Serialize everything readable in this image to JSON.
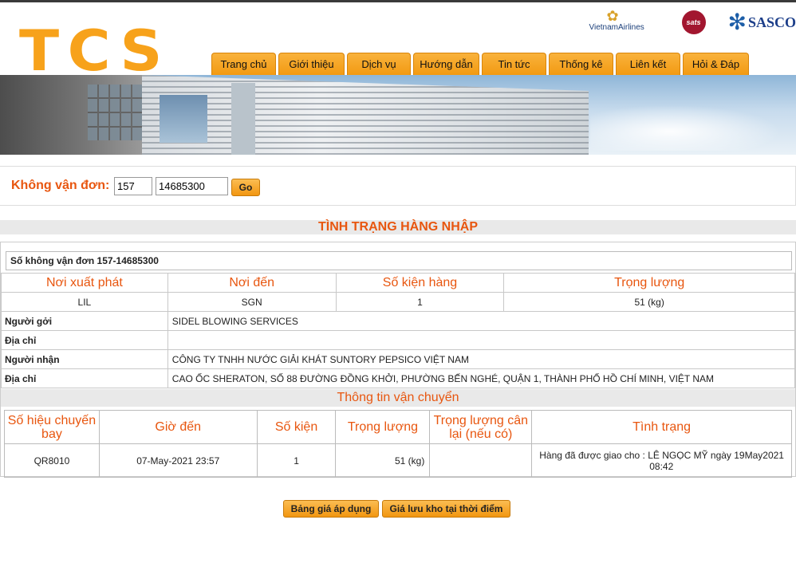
{
  "header": {
    "logo_text": "TCS",
    "partners": {
      "vietnam_airlines": "VietnamAirlines",
      "sats": "sats",
      "sasco": "SASCO"
    },
    "nav": [
      {
        "label": "Trang chủ"
      },
      {
        "label": "Giới thiệu"
      },
      {
        "label": "Dịch vụ"
      },
      {
        "label": "Hướng dẫn"
      },
      {
        "label": "Tin tức"
      },
      {
        "label": "Thống kê"
      },
      {
        "label": "Liên kết"
      },
      {
        "label": "Hỏi & Đáp"
      }
    ]
  },
  "search": {
    "label": "Không vận đơn:",
    "prefix_value": "157",
    "number_value": "14685300",
    "go_label": "Go"
  },
  "status": {
    "section_title": "TÌNH TRẠNG HÀNG NHẬP",
    "awb_line": "Số không vận đơn 157-14685300",
    "headers": [
      "Nơi xuất phát",
      "Nơi đến",
      "Số kiện hàng",
      "Trọng lượng"
    ],
    "values": [
      "LIL",
      "SGN",
      "1",
      "51 (kg)"
    ],
    "sender_label": "Người gởi",
    "sender_value": "SIDEL BLOWING SERVICES",
    "sender_address_label": "Địa chỉ",
    "sender_address_value": "",
    "receiver_label": "Người nhận",
    "receiver_value": "CÔNG TY TNHH NƯỚC GIẢI KHÁT SUNTORY PEPSICO VIỆT NAM",
    "receiver_address_label": "Địa chỉ",
    "receiver_address_value": "CAO ỐC SHERATON, SỐ 88 ĐƯỜNG ĐỒNG KHỞI, PHƯỜNG BẾN NGHÉ, QUẬN 1, THÀNH PHỐ HỒ CHÍ MINH, VIỆT NAM"
  },
  "transport": {
    "title": "Thông tin vận chuyển",
    "headers": [
      "Số hiệu chuyến bay",
      "Giờ đến",
      "Số kiện",
      "Trọng lượng",
      "Trọng lượng cân lại (nếu có)",
      "Tình trạng"
    ],
    "row": {
      "flight": "QR8010",
      "arrival": "07-May-2021 23:57",
      "pieces": "1",
      "weight": "51 (kg)",
      "reweight": "",
      "status_line1": "Hàng đã được giao cho : LÊ NGỌC MỸ ngày 19May2021",
      "status_line2": "08:42"
    }
  },
  "buttons": {
    "rates": "Bảng giá áp dụng",
    "storage": "Giá lưu kho tại thời điểm"
  },
  "colors": {
    "accent": "#f7a21b",
    "title_orange": "#e8560f",
    "nav_orange": "#f29a12"
  }
}
